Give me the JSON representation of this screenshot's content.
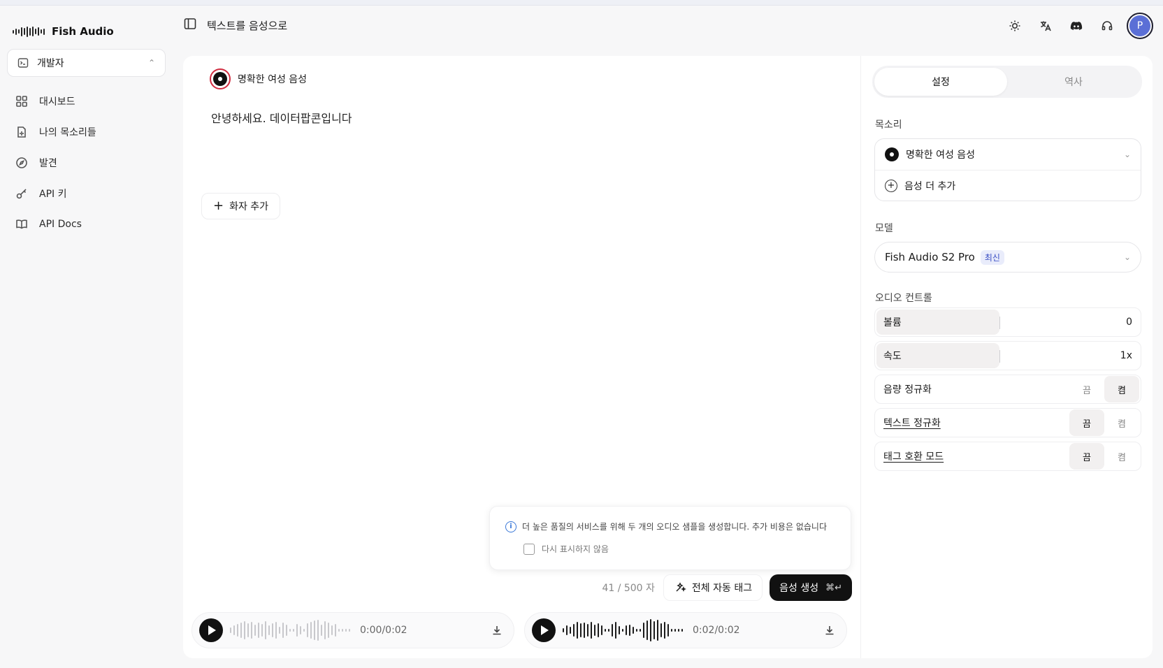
{
  "app": {
    "name": "Fish Audio",
    "page_title": "텍스트를 음성으로"
  },
  "sidebar": {
    "org_label": "개발자",
    "items": [
      {
        "label": "대시보드",
        "icon": "grid-icon"
      },
      {
        "label": "나의 목소리들",
        "icon": "file-voice-icon"
      },
      {
        "label": "발견",
        "icon": "compass-icon"
      },
      {
        "label": "API 키",
        "icon": "key-icon"
      },
      {
        "label": "API Docs",
        "icon": "book-icon"
      }
    ]
  },
  "header": {
    "avatar_initial": "P",
    "icons": [
      "sun-icon",
      "translate-icon",
      "discord-icon",
      "headset-icon"
    ]
  },
  "editor": {
    "speaker_name": "명확한 여성 음성",
    "text": "안녕하세요. 데이터팝콘입니다",
    "add_speaker_label": "화자 추가",
    "notice_text": "더 높은 품질의 서비스를 위해 두 개의 오디오 샘플을 생성합니다. 추가 비용은 없습니다",
    "dont_show_label": "다시 표시하지 않음",
    "char_count": "41 / 500 자",
    "auto_tag_label": "전체 자동 태그",
    "generate_label": "음성 생성",
    "generate_shortcut": "⌘↵"
  },
  "players": [
    {
      "time": "0:00/0:02",
      "progress": 0.0
    },
    {
      "time": "0:02/0:02",
      "progress": 1.0
    }
  ],
  "settings": {
    "tabs": [
      "설정",
      "역사"
    ],
    "active_tab": 0,
    "voice_label": "목소리",
    "voice_selected": "명확한 여성 음성",
    "add_voice_label": "음성 더 추가",
    "model_label": "모델",
    "model_selected": "Fish Audio S2 Pro",
    "model_badge": "최신",
    "audio_control_label": "오디오 컨트롤",
    "volume_label": "볼륨",
    "volume_value": "0",
    "speed_label": "속도",
    "speed_value": "1x",
    "loudness_norm_label": "음량 정규화",
    "text_norm_label": "텍스트 정규화",
    "tag_compat_label": "태그 호환 모드",
    "off_label": "끔",
    "on_label": "켬",
    "loudness_norm_on": true,
    "text_norm_on": false,
    "tag_compat_on": false
  },
  "colors": {
    "accent": "#5b6fd6",
    "voice_ring": "#d02c40",
    "badge_text": "#3b4fc4",
    "info_blue": "#3a78d8"
  }
}
